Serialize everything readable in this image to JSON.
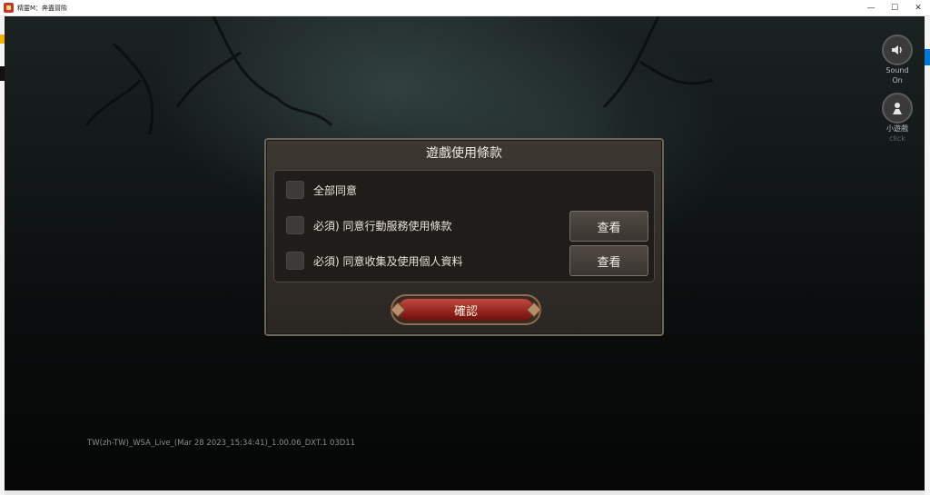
{
  "window": {
    "title": "精靈M：奔盡冒險",
    "controls": {
      "minimize": "—",
      "maximize": "☐",
      "close": "✕"
    }
  },
  "side_buttons": {
    "sound": {
      "icon": "speaker-icon",
      "label_line1": "Sound",
      "label_line2": "On"
    },
    "minigame": {
      "icon": "character-icon",
      "label": "小遊戲",
      "sublabel": "click"
    }
  },
  "dialog": {
    "title": "遊戲使用條款",
    "rows": [
      {
        "label": "全部同意",
        "checked": false
      },
      {
        "label": "必須) 同意行動服務使用條款",
        "checked": false,
        "button": "查看"
      },
      {
        "label": "必須) 同意收集及使用個人資料",
        "checked": false,
        "button": "查看"
      }
    ],
    "confirm_label": "確認"
  },
  "version_text": "TW(zh-TW)_WSA_Live_(Mar 28 2023_15:34:41)_1.00.06_DXT.1 03D11",
  "colors": {
    "confirm": "#8a1c16",
    "dialog_bg": "#2f2a25",
    "accent_border": "#6b6459"
  }
}
